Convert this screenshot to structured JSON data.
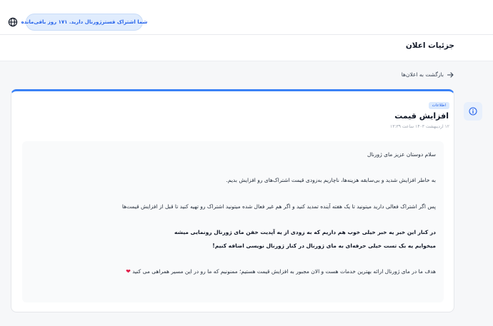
{
  "topbar": {
    "subscription_notice": "شما اشتراک قسترژورنال دارید. ۱۷۱ روز باقی‌مانده",
    "language_icon": "globe-icon"
  },
  "header": {
    "page_title": "جزئیات اعلان"
  },
  "back": {
    "label": "بازگشت به اعلان‌ها",
    "icon": "arrow-right-icon"
  },
  "announcement": {
    "badge": "اطلاعات",
    "icon": "info-icon",
    "title": "افزایش قیمت",
    "date": "۱۲ اردیبهشت ۱۴۰۳ ساعت ۱۳:۳۹",
    "paragraphs": [
      "سلام دوستان عزیز مای ژورنال",
      "به خاطر افزایش شدید و بی‌سابقه هزینه‌ها، ناچاریم به‌زودی قیمت اشتراک‌های رو افزایش بدیم.",
      "پس اگر اشتراک فعالی دارید میتونید تا یک هفته آینده تمدید کنید و اگر هم غیر فعال شده میتونید اشتراک رو تهیه کنید تا قبل از افزایش قیمت‌ها",
      "در کنار این خبر یه خبر خیلی خوب هم داریم که به زودی از یه آپدیت خفن مای ژورنال رونمایی میشه",
      "میخوایم یه بک تست خیلی حرفه‌ای به مای ژورنال در کنار ژورنال نویسی اضافه کنیم!",
      "هدف ما در مای ژورنال ارائه بهترین خدمات هست و الان مجبور به افزایش قیمت هستیم؛ ممنونیم که ما رو در این مسیر همراهی می کنید"
    ],
    "heart": "❤"
  },
  "colors": {
    "accent": "#3b82f6",
    "badge_bg": "#dbeafe",
    "heart": "#e11d48"
  }
}
